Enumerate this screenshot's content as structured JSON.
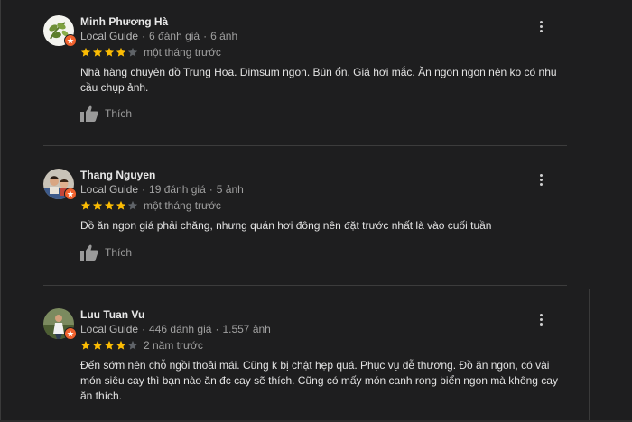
{
  "reviews": [
    {
      "name": "Minh Phương Hà",
      "guide": "Local Guide",
      "reviews_count": "6 đánh giá",
      "photos_count": "6 ảnh",
      "rating": 4,
      "time": "một tháng trước",
      "text": "Nhà hàng chuyên đồ Trung Hoa. Dimsum ngon. Bún ổn. Giá hơi mắc. Ăn ngon ngon nên ko có nhu cầu chụp ảnh.",
      "like_label": "Thích"
    },
    {
      "name": "Thang Nguyen",
      "guide": "Local Guide",
      "reviews_count": "19 đánh giá",
      "photos_count": "5 ảnh",
      "rating": 4,
      "time": "một tháng trước",
      "text": "Đồ ăn ngon giá phải chăng, nhưng quán hơi đông nên đặt trước nhất là vào cuối tuần",
      "like_label": "Thích"
    },
    {
      "name": "Luu Tuan Vu",
      "guide": "Local Guide",
      "reviews_count": "446 đánh giá",
      "photos_count": "1.557 ảnh",
      "rating": 4,
      "time": "2 năm trước",
      "text": "Đến sớm nên chỗ ngồi thoải mái. Cũng k bị chật hẹp quá. Phục vụ dễ thương. Đồ ăn ngon, có vài món siêu cay thì bạn nào ăn đc cay sẽ thích. Cũng có mấy món canh rong biển ngon mà không cay ăn thích."
    }
  ],
  "colors": {
    "star_filled": "#fbbc04",
    "star_empty": "#5f6368",
    "badge": "#f0612d",
    "background": "#1e1e1f"
  },
  "icons": {
    "menu": "more-vert-icon",
    "like": "thumb-up-icon",
    "badge": "local-guide-badge-icon"
  }
}
